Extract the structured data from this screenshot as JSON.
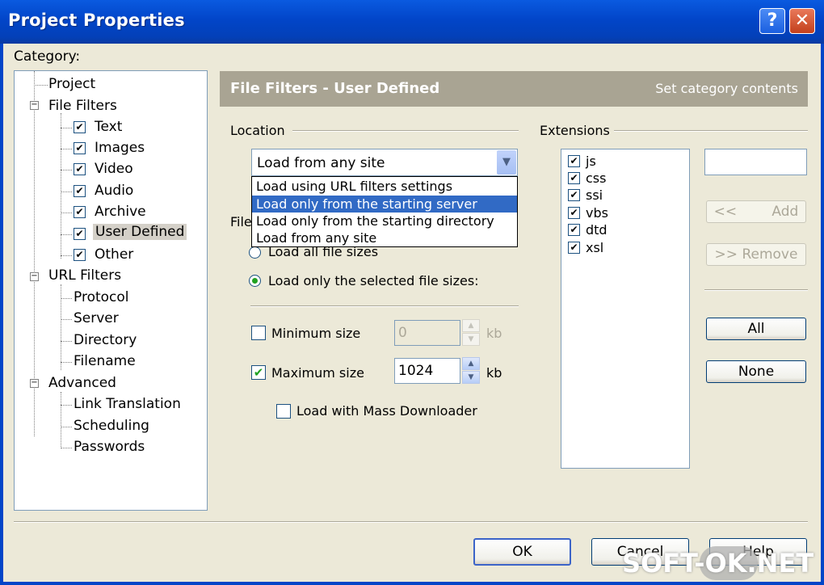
{
  "window": {
    "title": "Project Properties",
    "help_glyph": "?",
    "close_glyph": "✕"
  },
  "category_label": "Category:",
  "tree": {
    "items": [
      {
        "label": "Project"
      },
      {
        "label": "File Filters",
        "expander": "−"
      },
      {
        "label": "Text",
        "checked": "✔"
      },
      {
        "label": "Images",
        "checked": "✔"
      },
      {
        "label": "Video",
        "checked": "✔"
      },
      {
        "label": "Audio",
        "checked": "✔"
      },
      {
        "label": "Archive",
        "checked": "✔"
      },
      {
        "label": "User Defined",
        "checked": "✔",
        "selected": true
      },
      {
        "label": "Other",
        "checked": "✔"
      },
      {
        "label": "URL Filters",
        "expander": "−"
      },
      {
        "label": "Protocol"
      },
      {
        "label": "Server"
      },
      {
        "label": "Directory"
      },
      {
        "label": "Filename"
      },
      {
        "label": "Advanced",
        "expander": "−"
      },
      {
        "label": "Link Translation"
      },
      {
        "label": "Scheduling"
      },
      {
        "label": "Passwords"
      }
    ]
  },
  "header": {
    "title": "File Filters - User Defined",
    "subtitle": "Set category contents"
  },
  "location": {
    "label": "Location",
    "selected": "Load from any site",
    "options": [
      "Load using URL filters settings",
      "Load only from the starting server",
      "Load only from the starting directory",
      "Load from any site"
    ],
    "highlighted_option": "Load only from the starting server"
  },
  "filesize": {
    "label_partial": "File",
    "radio_all": "Load all file sizes",
    "radio_selected": "Load only the selected file sizes:",
    "min_label": "Minimum size",
    "min_value": "0",
    "min_unit": "kb",
    "max_label": "Maximum size",
    "max_value": "1024",
    "max_unit": "kb",
    "mass_label": "Load with Mass Downloader",
    "check_glyph": "✔"
  },
  "extensions": {
    "label": "Extensions",
    "items": [
      "js",
      "css",
      "ssi",
      "vbs",
      "dtd",
      "xsl"
    ],
    "check_glyph": "✔",
    "add_label": "<<        Add",
    "remove_label": ">> Remove",
    "all_label": "All",
    "none_label": "None"
  },
  "footer": {
    "ok": "OK",
    "cancel": "Cancel",
    "help": "Help"
  },
  "watermark": "SOFT-OK.NET"
}
